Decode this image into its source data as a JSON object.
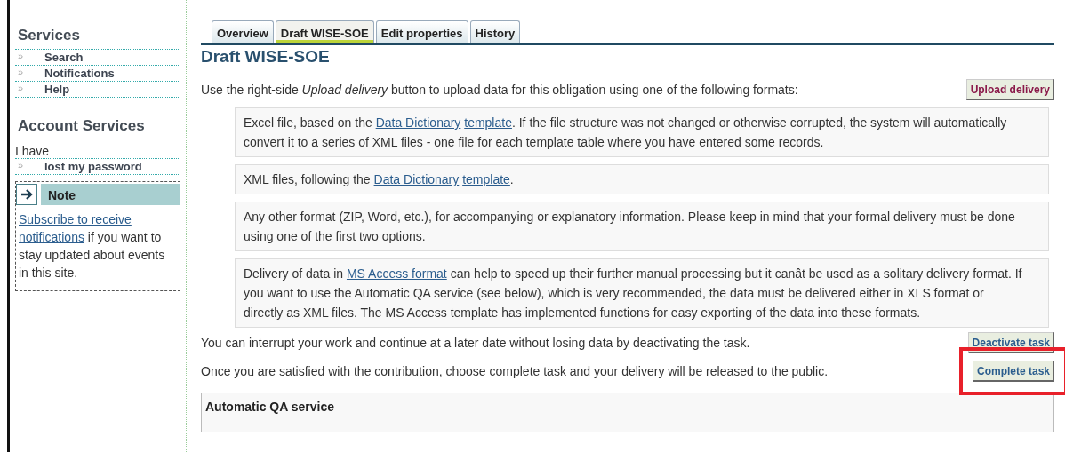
{
  "sidebar": {
    "sections": [
      {
        "title": "Services",
        "items": [
          {
            "marker": "»",
            "label": "Search"
          },
          {
            "marker": "»",
            "label": "Notifications"
          },
          {
            "marker": "»",
            "label": "Help"
          }
        ]
      },
      {
        "title": "Account Services",
        "intro": "I have",
        "items": [
          {
            "marker": "»",
            "label": "lost my password"
          }
        ]
      }
    ],
    "note": {
      "title": "Note",
      "text": [
        {
          "kind": "link",
          "text": "Subscribe to receive"
        },
        {
          "kind": "link",
          "text": "notifications"
        },
        {
          "kind": "text",
          "text": " if you want to stay updated about events in this site."
        }
      ]
    }
  },
  "tabs": [
    {
      "label": "Overview",
      "selected": false
    },
    {
      "label": "Draft WISE-SOE",
      "selected": true
    },
    {
      "label": "Edit properties",
      "selected": false
    },
    {
      "label": "History",
      "selected": false
    }
  ],
  "heading": "Draft WISE-SOE",
  "intro": {
    "text": "Use the right-side *Upload delivery* button to upload data for this obligation using one of the following formats:",
    "button": "Upload delivery"
  },
  "formats": [
    [
      {
        "kind": "text",
        "text": "Excel file, based on the "
      },
      {
        "kind": "link",
        "text": "Data Dictionary"
      },
      {
        "kind": "link",
        "text": "template"
      },
      {
        "kind": "text",
        "text": ". If the file structure was not changed or otherwise corrupted, the system will automatically convert it to a series of XML files - one file for each template table where you have entered some records."
      }
    ],
    [
      {
        "kind": "text",
        "text": "XML files, following the "
      },
      {
        "kind": "link",
        "text": "Data Dictionary"
      },
      {
        "kind": "link",
        "text": "template"
      },
      {
        "kind": "text",
        "text": "."
      }
    ],
    [
      {
        "kind": "text",
        "text": "Any other format (ZIP, Word, etc.), for accompanying or explanatory information. Please keep in mind that your formal delivery must be done using one of the first two options."
      }
    ],
    [
      {
        "kind": "text",
        "text": "Delivery of data in "
      },
      {
        "kind": "link",
        "text": "MS Access format"
      },
      {
        "kind": "text",
        "text": " can help to speed up their further manual processing but it canât be used as a solitary delivery format. If you want to use the Automatic QA service (see below), which is very recommended, the data must be delivered either in XLS format or directly as XML files. The MS Access template has implemented functions for easy exporting of the data into these formats."
      }
    ]
  ],
  "actions": [
    {
      "text": "You can interrupt your work and continue at a later date without losing data by deactivating the task.",
      "button": "Deactivate task",
      "highlighted": false
    },
    {
      "text": "Once you are satisfied with the contribution, choose complete task and your delivery will be released to the public.",
      "button": "Complete task",
      "highlighted": true
    }
  ],
  "qa_panel": {
    "title": "Automatic QA service"
  }
}
